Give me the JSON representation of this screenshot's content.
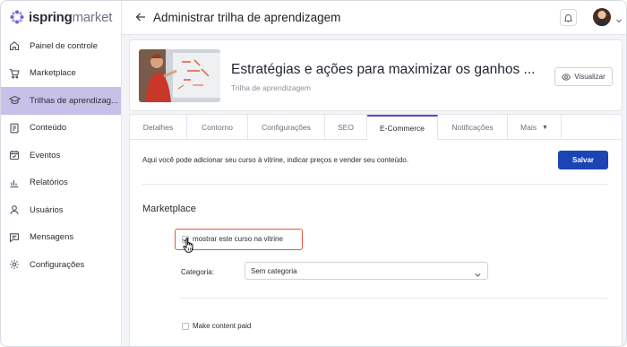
{
  "app": {
    "logo_prefix": "ispring",
    "logo_suffix": "market"
  },
  "sidebar": {
    "items": [
      {
        "label": "Painel de controle",
        "icon": "home-icon"
      },
      {
        "label": "Marketplace",
        "icon": "cart-icon"
      },
      {
        "label": "Trilhas de aprendizag...",
        "icon": "graduation-cap-icon",
        "active": true
      },
      {
        "label": "Conteúdo",
        "icon": "book-icon"
      },
      {
        "label": "Eventos",
        "icon": "calendar-icon"
      },
      {
        "label": "Relatórios",
        "icon": "bar-chart-icon"
      },
      {
        "label": "Usuários",
        "icon": "user-icon"
      },
      {
        "label": "Mensagens",
        "icon": "message-icon"
      },
      {
        "label": "Configurações",
        "icon": "gear-icon"
      }
    ]
  },
  "header": {
    "title": "Administrar trilha de aprendizagem"
  },
  "course": {
    "title": "Estratégias e ações para maximizar os ganhos ...",
    "subtitle": "Trilha de aprendizagem",
    "view_label": "Visualizar"
  },
  "tabs": [
    {
      "label": "Detalhes"
    },
    {
      "label": "Contorno"
    },
    {
      "label": "Configurações"
    },
    {
      "label": "SEO"
    },
    {
      "label": "E-Commerce",
      "active": true
    },
    {
      "label": "Notificações"
    },
    {
      "label": "Mais"
    }
  ],
  "ecommerce": {
    "intro": "Aqui você pode adicionar seu curso à vitrine, indicar preços e vender seu conteúdo.",
    "save_label": "Salvar",
    "section_title": "Marketplace",
    "show_in_store_label": "mostrar este curso na vitrine",
    "show_in_store_checked": true,
    "category_label": "Categoria:",
    "category_value": "Sem categoria",
    "make_paid_label": "Make content paid",
    "make_paid_checked": false
  },
  "colors": {
    "accent": "#5b48c8",
    "active_nav": "#c7c1e9",
    "primary_button": "#1b45b4",
    "highlight": "#e15a3c"
  }
}
